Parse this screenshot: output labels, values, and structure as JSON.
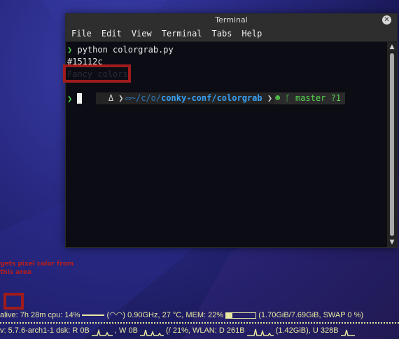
{
  "window": {
    "title": "Terminal",
    "close_glyph": "✕",
    "menu": [
      "File",
      "Edit",
      "View",
      "Terminal",
      "Tabs",
      "Help"
    ]
  },
  "terminal": {
    "prompt_glyph": "❯",
    "command": "python colorgrab.py",
    "output_line": "#15112c",
    "faded_text": "Fancy colors!",
    "prompt": {
      "user_glyph": "Δ",
      "sep_glyph": "❯",
      "path_prefix": "~/c/o/",
      "path_current": "conky-conf/colorgrab",
      "git_branch": "master",
      "git_status": "?1"
    }
  },
  "annotation": {
    "text": "gets pixel color from this area"
  },
  "conky": {
    "row1": {
      "uptime": "alive: 7h 28m cpu: 14%",
      "cpu_info": "0.90GHz, 27 °C, MEM: 22%",
      "mem_detail": "(1.70GiB/7.69GiB, SWAP 0 %)",
      "mem_fraction": 0.22
    },
    "row2": {
      "kernel": "v: 5.7.6-arch1-1 dsk: R 0B",
      "disk_write": ", W 0B",
      "root": "(/ 21%,",
      "wlan": "WLAN: D 261B",
      "upload": "(1.42GiB), U 328B"
    }
  },
  "colors": {
    "accent_red": "#a01b1b",
    "prompt_green": "#4cd14a",
    "path_blue": "#38a1f5",
    "conky_text": "#e8e8a0"
  }
}
